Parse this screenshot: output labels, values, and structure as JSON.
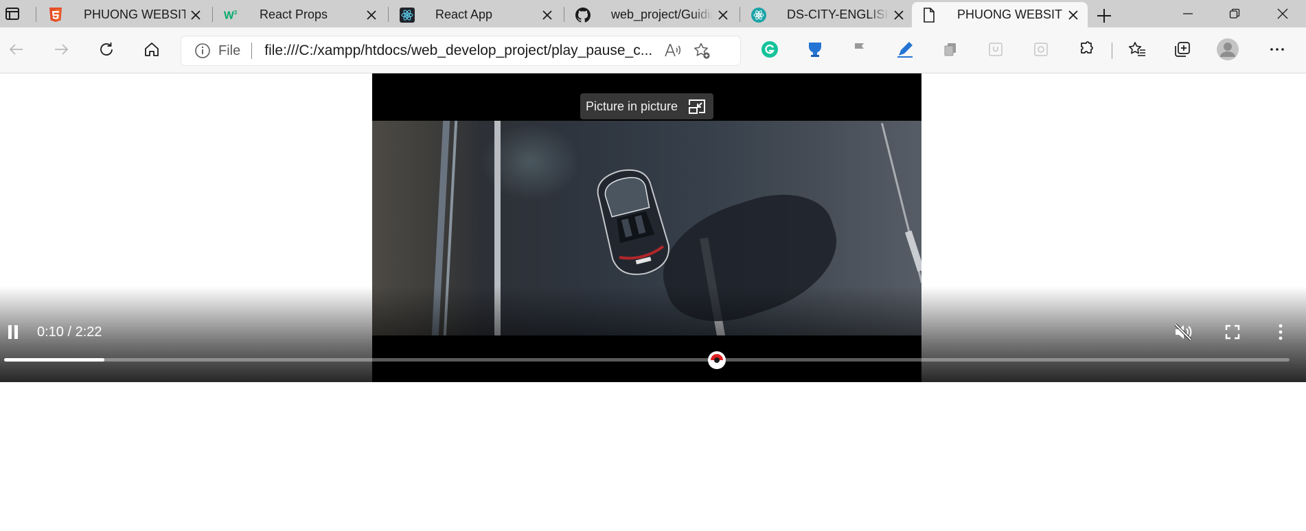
{
  "tabs": [
    {
      "title": "PHUONG WEBSITE",
      "favicon": "html5-icon",
      "active": false
    },
    {
      "title": "React Props",
      "favicon": "w3schools-icon",
      "active": false
    },
    {
      "title": "React App",
      "favicon": "react-icon",
      "active": false
    },
    {
      "title": "web_project/Guidin",
      "favicon": "github-icon",
      "active": false
    },
    {
      "title": "DS-CITY-ENGLISH-T",
      "favicon": "teal-react-icon",
      "active": false
    },
    {
      "title": "PHUONG WEBSITE",
      "favicon": "document-icon",
      "active": true
    }
  ],
  "address_bar": {
    "scheme_label": "File",
    "url": "file:///C:/xampp/htdocs/web_develop_project/play_pause_c..."
  },
  "video": {
    "pip_label": "Picture in picture",
    "time_display": "0:10 / 2:22",
    "progress": 0.078,
    "state": "playing",
    "muted": true
  },
  "colors": {
    "tabstrip_bg": "#cfcfcf",
    "toolbar_bg": "#f7f7f7",
    "seek_thumb_accent": "#e02020",
    "grammarly_green": "#15c39a",
    "extension_blue": "#2474d4"
  }
}
